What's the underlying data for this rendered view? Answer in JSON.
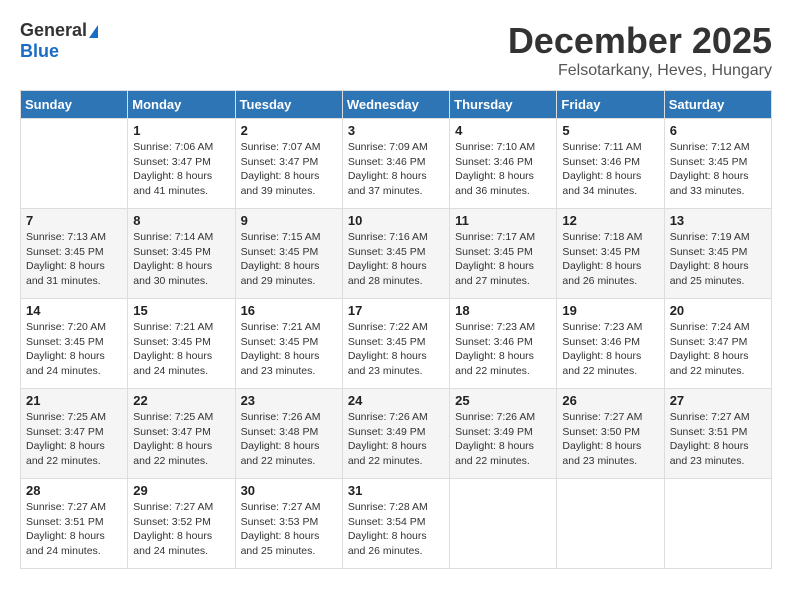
{
  "logo": {
    "general": "General",
    "blue": "Blue"
  },
  "title": {
    "month": "December 2025",
    "location": "Felsotarkany, Heves, Hungary"
  },
  "headers": [
    "Sunday",
    "Monday",
    "Tuesday",
    "Wednesday",
    "Thursday",
    "Friday",
    "Saturday"
  ],
  "weeks": [
    [
      {
        "day": "",
        "info": ""
      },
      {
        "day": "1",
        "info": "Sunrise: 7:06 AM\nSunset: 3:47 PM\nDaylight: 8 hours\nand 41 minutes."
      },
      {
        "day": "2",
        "info": "Sunrise: 7:07 AM\nSunset: 3:47 PM\nDaylight: 8 hours\nand 39 minutes."
      },
      {
        "day": "3",
        "info": "Sunrise: 7:09 AM\nSunset: 3:46 PM\nDaylight: 8 hours\nand 37 minutes."
      },
      {
        "day": "4",
        "info": "Sunrise: 7:10 AM\nSunset: 3:46 PM\nDaylight: 8 hours\nand 36 minutes."
      },
      {
        "day": "5",
        "info": "Sunrise: 7:11 AM\nSunset: 3:46 PM\nDaylight: 8 hours\nand 34 minutes."
      },
      {
        "day": "6",
        "info": "Sunrise: 7:12 AM\nSunset: 3:45 PM\nDaylight: 8 hours\nand 33 minutes."
      }
    ],
    [
      {
        "day": "7",
        "info": "Sunrise: 7:13 AM\nSunset: 3:45 PM\nDaylight: 8 hours\nand 31 minutes."
      },
      {
        "day": "8",
        "info": "Sunrise: 7:14 AM\nSunset: 3:45 PM\nDaylight: 8 hours\nand 30 minutes."
      },
      {
        "day": "9",
        "info": "Sunrise: 7:15 AM\nSunset: 3:45 PM\nDaylight: 8 hours\nand 29 minutes."
      },
      {
        "day": "10",
        "info": "Sunrise: 7:16 AM\nSunset: 3:45 PM\nDaylight: 8 hours\nand 28 minutes."
      },
      {
        "day": "11",
        "info": "Sunrise: 7:17 AM\nSunset: 3:45 PM\nDaylight: 8 hours\nand 27 minutes."
      },
      {
        "day": "12",
        "info": "Sunrise: 7:18 AM\nSunset: 3:45 PM\nDaylight: 8 hours\nand 26 minutes."
      },
      {
        "day": "13",
        "info": "Sunrise: 7:19 AM\nSunset: 3:45 PM\nDaylight: 8 hours\nand 25 minutes."
      }
    ],
    [
      {
        "day": "14",
        "info": "Sunrise: 7:20 AM\nSunset: 3:45 PM\nDaylight: 8 hours\nand 24 minutes."
      },
      {
        "day": "15",
        "info": "Sunrise: 7:21 AM\nSunset: 3:45 PM\nDaylight: 8 hours\nand 24 minutes."
      },
      {
        "day": "16",
        "info": "Sunrise: 7:21 AM\nSunset: 3:45 PM\nDaylight: 8 hours\nand 23 minutes."
      },
      {
        "day": "17",
        "info": "Sunrise: 7:22 AM\nSunset: 3:45 PM\nDaylight: 8 hours\nand 23 minutes."
      },
      {
        "day": "18",
        "info": "Sunrise: 7:23 AM\nSunset: 3:46 PM\nDaylight: 8 hours\nand 22 minutes."
      },
      {
        "day": "19",
        "info": "Sunrise: 7:23 AM\nSunset: 3:46 PM\nDaylight: 8 hours\nand 22 minutes."
      },
      {
        "day": "20",
        "info": "Sunrise: 7:24 AM\nSunset: 3:47 PM\nDaylight: 8 hours\nand 22 minutes."
      }
    ],
    [
      {
        "day": "21",
        "info": "Sunrise: 7:25 AM\nSunset: 3:47 PM\nDaylight: 8 hours\nand 22 minutes."
      },
      {
        "day": "22",
        "info": "Sunrise: 7:25 AM\nSunset: 3:47 PM\nDaylight: 8 hours\nand 22 minutes."
      },
      {
        "day": "23",
        "info": "Sunrise: 7:26 AM\nSunset: 3:48 PM\nDaylight: 8 hours\nand 22 minutes."
      },
      {
        "day": "24",
        "info": "Sunrise: 7:26 AM\nSunset: 3:49 PM\nDaylight: 8 hours\nand 22 minutes."
      },
      {
        "day": "25",
        "info": "Sunrise: 7:26 AM\nSunset: 3:49 PM\nDaylight: 8 hours\nand 22 minutes."
      },
      {
        "day": "26",
        "info": "Sunrise: 7:27 AM\nSunset: 3:50 PM\nDaylight: 8 hours\nand 23 minutes."
      },
      {
        "day": "27",
        "info": "Sunrise: 7:27 AM\nSunset: 3:51 PM\nDaylight: 8 hours\nand 23 minutes."
      }
    ],
    [
      {
        "day": "28",
        "info": "Sunrise: 7:27 AM\nSunset: 3:51 PM\nDaylight: 8 hours\nand 24 minutes."
      },
      {
        "day": "29",
        "info": "Sunrise: 7:27 AM\nSunset: 3:52 PM\nDaylight: 8 hours\nand 24 minutes."
      },
      {
        "day": "30",
        "info": "Sunrise: 7:27 AM\nSunset: 3:53 PM\nDaylight: 8 hours\nand 25 minutes."
      },
      {
        "day": "31",
        "info": "Sunrise: 7:28 AM\nSunset: 3:54 PM\nDaylight: 8 hours\nand 26 minutes."
      },
      {
        "day": "",
        "info": ""
      },
      {
        "day": "",
        "info": ""
      },
      {
        "day": "",
        "info": ""
      }
    ]
  ]
}
